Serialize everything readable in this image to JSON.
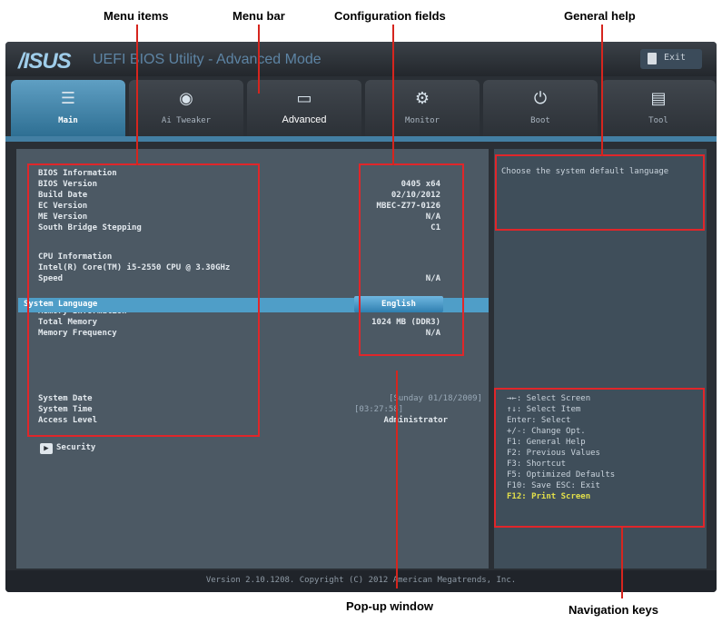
{
  "annotations": {
    "menu_items": "Menu items",
    "menu_bar": "Menu bar",
    "config_fields": "Configuration fields",
    "general_help": "General help",
    "popup_window": "Pop-up window",
    "navigation_keys": "Navigation keys"
  },
  "titlebar": {
    "logo": "/ISUS",
    "title": "UEFI BIOS Utility - Advanced Mode",
    "exit_label": "Exit"
  },
  "tabs": [
    {
      "label": "Main",
      "icon": "list-icon",
      "glyph": "☰"
    },
    {
      "label": "Ai Tweaker",
      "icon": "tweaker-icon",
      "glyph": "◉"
    },
    {
      "label": "Advanced",
      "icon": "advanced-icon",
      "glyph": "▭"
    },
    {
      "label": "Monitor",
      "icon": "monitor-icon",
      "glyph": "⚙"
    },
    {
      "label": "Boot",
      "icon": "power-icon",
      "glyph": "⏻"
    },
    {
      "label": "Tool",
      "icon": "printer-icon",
      "glyph": "▤"
    }
  ],
  "main": {
    "bios_info_heading": "BIOS Information",
    "bios_version_label": "BIOS Version",
    "bios_version_value": "0405 x64",
    "build_date_label": "Build Date",
    "build_date_value": "02/10/2012",
    "ec_version_label": "EC Version",
    "ec_version_value": "MBEC-Z77-0126",
    "me_version_label": "ME Version",
    "me_version_value": "N/A",
    "south_bridge_label": "South Bridge Stepping",
    "south_bridge_value": "C1",
    "cpu_info_heading": "CPU Information",
    "cpu_model": "Intel(R) Core(TM) i5-2550 CPU @ 3.30GHz",
    "speed_label": "Speed",
    "speed_value": "N/A",
    "mem_info_heading": "Memory Information",
    "total_memory_label": "Total Memory",
    "total_memory_value": "1024 MB (DDR3)",
    "memory_freq_label": "Memory Frequency",
    "memory_freq_value": "N/A",
    "system_language_label": "System Language",
    "system_language_value": "English",
    "system_date_label": "System Date",
    "system_date_value": "[Sunday 01/18/2009]",
    "system_time_label": "System Time",
    "system_time_value": "[03:27:58]",
    "access_level_label": "Access Level",
    "access_level_value": "Administrator",
    "security_label": "Security"
  },
  "help": {
    "general_help_text": "Choose the system default language",
    "nav_keys": [
      "→←: Select Screen",
      "↑↓: Select Item",
      "Enter: Select",
      "+/-: Change Opt.",
      "F1: General Help",
      "F2: Previous Values",
      "F3: Shortcut",
      "F5: Optimized Defaults",
      "F10: Save  ESC: Exit",
      "F12: Print Screen"
    ]
  },
  "footer": {
    "text": "Version 2.10.1208. Copyright (C) 2012 American Megatrends, Inc."
  },
  "colors": {
    "annotation_red": "#e0262a",
    "active_tab": "#4f9ec8",
    "highlight_key": "#e3e04a"
  }
}
